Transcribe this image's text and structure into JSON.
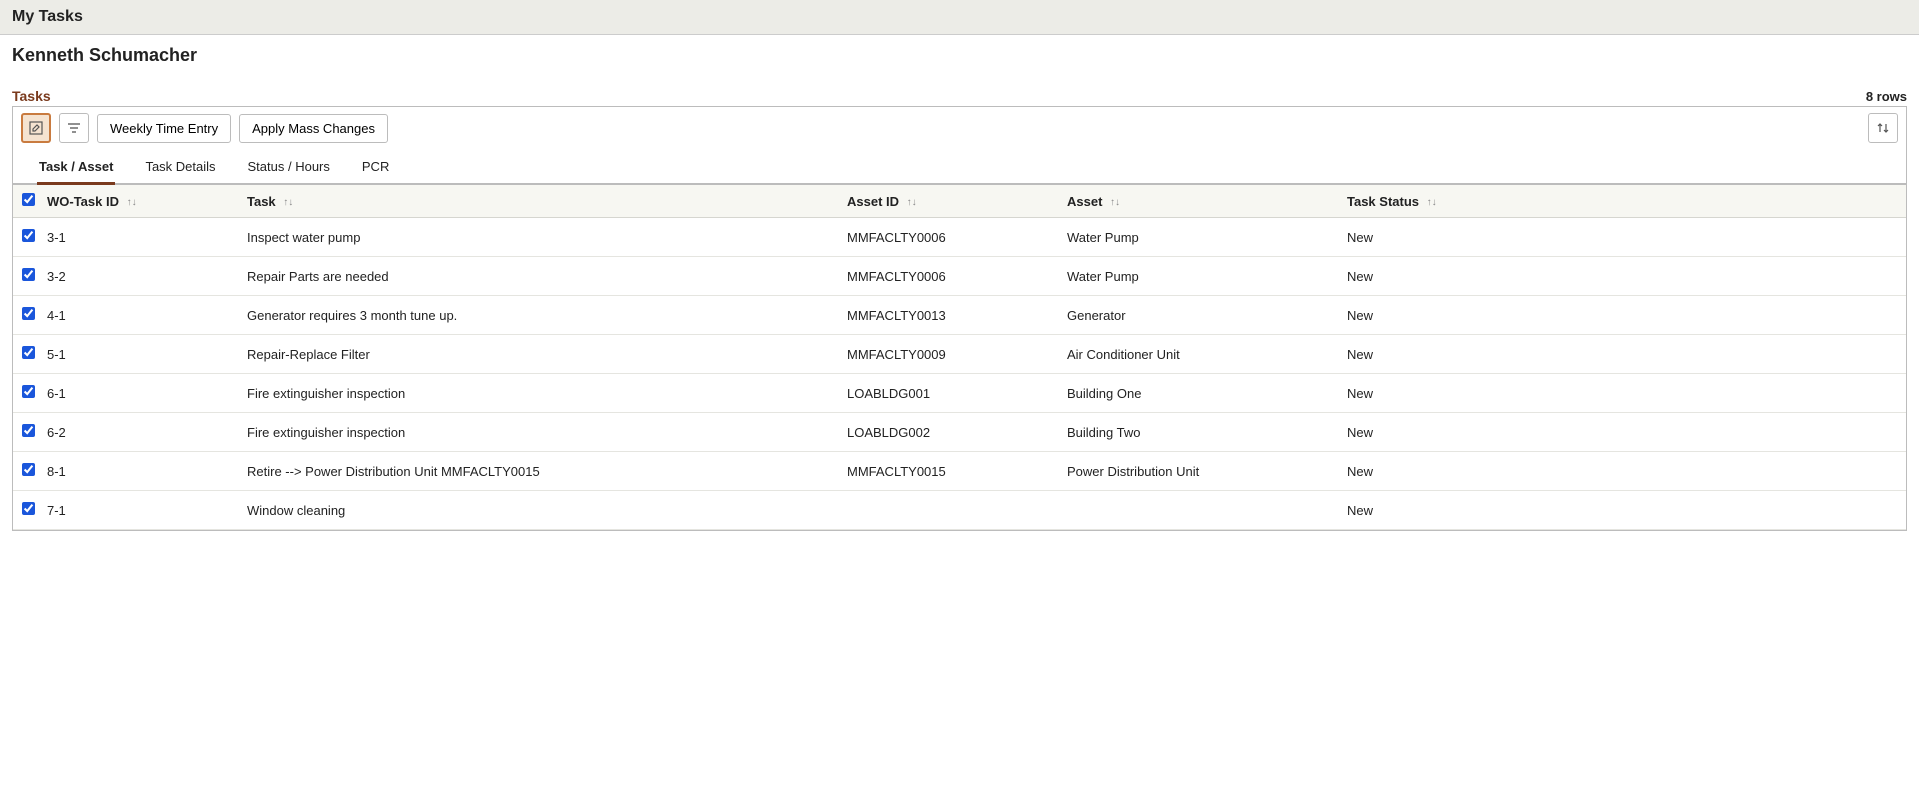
{
  "page": {
    "title": "My Tasks",
    "user_name": "Kenneth Schumacher"
  },
  "section": {
    "title": "Tasks",
    "row_count": "8 rows"
  },
  "toolbar": {
    "weekly_time_entry": "Weekly Time Entry",
    "apply_mass_changes": "Apply Mass Changes"
  },
  "tabs": [
    {
      "label": "Task / Asset",
      "active": true
    },
    {
      "label": "Task Details",
      "active": false
    },
    {
      "label": "Status / Hours",
      "active": false
    },
    {
      "label": "PCR",
      "active": false
    }
  ],
  "columns": {
    "wo_task_id": "WO-Task ID",
    "task": "Task",
    "asset_id": "Asset ID",
    "asset": "Asset",
    "task_status": "Task Status"
  },
  "rows": [
    {
      "checked": true,
      "wo_task_id": "3-1",
      "task": "Inspect water pump",
      "asset_id": "MMFACLTY0006",
      "asset": "Water Pump",
      "status": "New"
    },
    {
      "checked": true,
      "wo_task_id": "3-2",
      "task": "Repair Parts are needed",
      "asset_id": "MMFACLTY0006",
      "asset": "Water Pump",
      "status": "New"
    },
    {
      "checked": true,
      "wo_task_id": "4-1",
      "task": "Generator requires 3 month tune up.",
      "asset_id": "MMFACLTY0013",
      "asset": "Generator",
      "status": "New"
    },
    {
      "checked": true,
      "wo_task_id": "5-1",
      "task": "Repair-Replace Filter",
      "asset_id": "MMFACLTY0009",
      "asset": "Air Conditioner Unit",
      "status": "New"
    },
    {
      "checked": true,
      "wo_task_id": "6-1",
      "task": "Fire extinguisher inspection",
      "asset_id": "LOABLDG001",
      "asset": "Building One",
      "status": "New"
    },
    {
      "checked": true,
      "wo_task_id": "6-2",
      "task": "Fire extinguisher inspection",
      "asset_id": "LOABLDG002",
      "asset": "Building Two",
      "status": "New"
    },
    {
      "checked": true,
      "wo_task_id": "8-1",
      "task": "Retire --> Power Distribution Unit MMFACLTY0015",
      "asset_id": "MMFACLTY0015",
      "asset": "Power Distribution Unit",
      "status": "New"
    },
    {
      "checked": true,
      "wo_task_id": "7-1",
      "task": "Window cleaning",
      "asset_id": "",
      "asset": "",
      "status": "New"
    }
  ]
}
